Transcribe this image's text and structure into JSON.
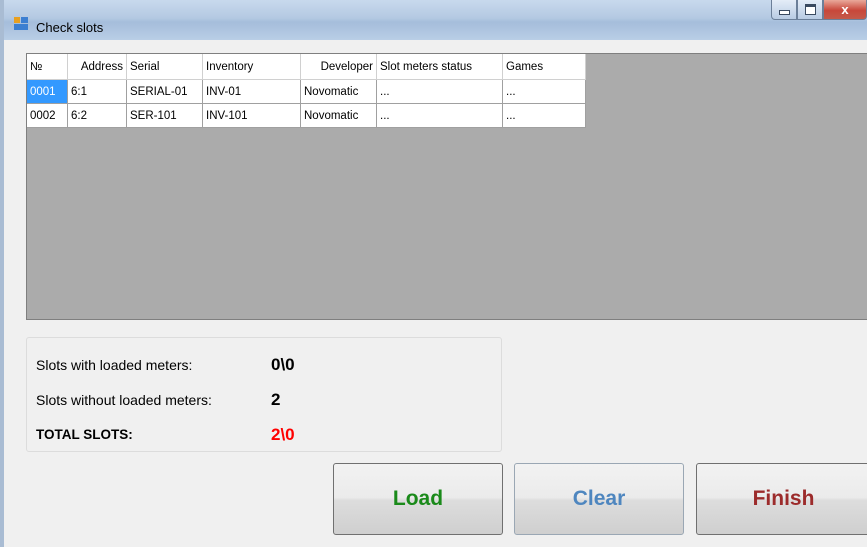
{
  "window": {
    "title": "Check slots",
    "close_glyph": "x"
  },
  "table": {
    "columns": [
      "№",
      "Address",
      "Serial",
      "Inventory",
      "Developer",
      "Slot meters status",
      "Games"
    ],
    "rows": [
      [
        "0001",
        "6:1",
        "SERIAL-01",
        "INV-01",
        "Novomatic",
        "...",
        "..."
      ],
      [
        "0002",
        "6:2",
        "SER-101",
        "INV-101",
        "Novomatic",
        "...",
        "..."
      ]
    ]
  },
  "stats": {
    "loaded_label": "Slots with loaded meters:",
    "loaded_value": "0\\0",
    "unloaded_label": "Slots without loaded meters:",
    "unloaded_value": "2",
    "total_label": "TOTAL SLOTS:",
    "total_value": "2\\0"
  },
  "buttons": {
    "load": "Load",
    "clear": "Clear",
    "finish": "Finish"
  },
  "colors": {
    "load": "#1a8a1a",
    "clear": "#4e86bf",
    "finish": "#9c2b2b",
    "total": "#ff0000",
    "selection": "#3399ff"
  }
}
